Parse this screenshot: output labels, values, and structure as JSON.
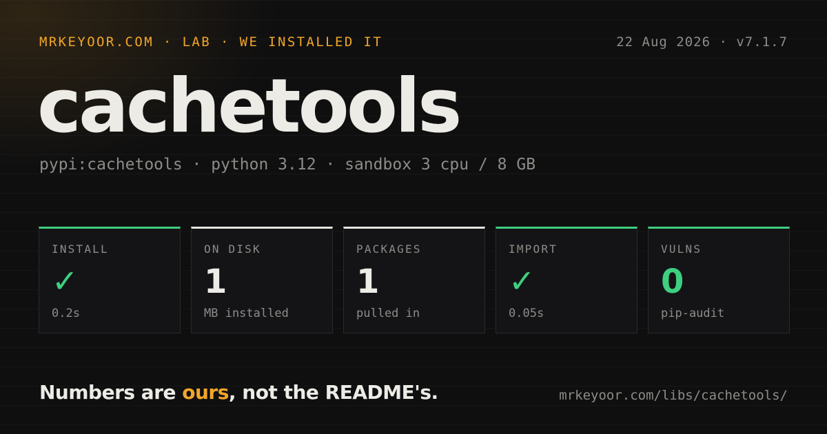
{
  "header": {
    "kicker": "MRKEYOOR.COM · LAB · WE INSTALLED IT",
    "date_version": "22 Aug 2026 · v7.1.7"
  },
  "package": {
    "name": "cachetools",
    "details": "pypi:cachetools · python 3.12 · sandbox 3 cpu / 8 GB"
  },
  "stats": [
    {
      "label": "INSTALL",
      "value": "✓",
      "sub": "0.2s",
      "accent": "#3ecf7f"
    },
    {
      "label": "ON DISK",
      "value": "1",
      "sub": "MB installed",
      "accent": "#e6e4df"
    },
    {
      "label": "PACKAGES",
      "value": "1",
      "sub": "pulled in",
      "accent": "#e6e4df"
    },
    {
      "label": "IMPORT",
      "value": "✓",
      "sub": "0.05s",
      "accent": "#3ecf7f"
    },
    {
      "label": "VULNS",
      "value": "0",
      "sub": "pip-audit",
      "accent": "#3ecf7f"
    }
  ],
  "footer": {
    "tagline_pre": "Numbers are ",
    "tagline_highlight": "ours",
    "tagline_post": ", not the README's.",
    "url": "mrkeyoor.com/libs/cachetools/"
  },
  "colors": {
    "accent_orange": "#f2a62a",
    "success_green": "#3ecf7f",
    "background": "#0f0f10",
    "muted_text": "#8e8c88"
  }
}
